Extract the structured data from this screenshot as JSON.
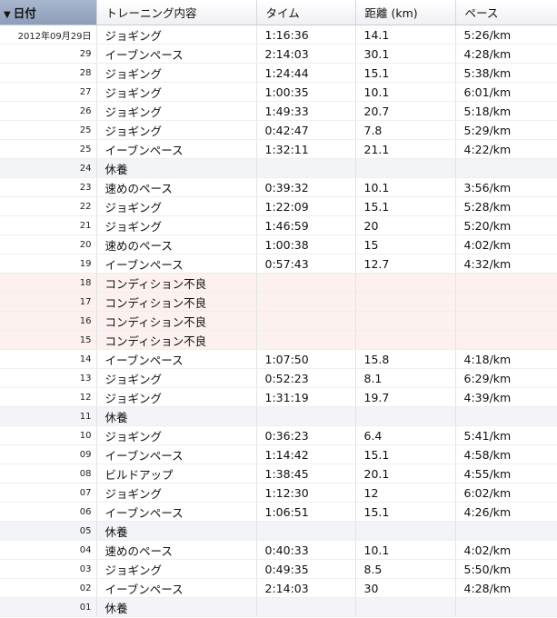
{
  "headers": {
    "date": "日付",
    "type": "トレーニング内容",
    "time": "タイム",
    "distance": "距離 (km)",
    "pace": "ペース"
  },
  "sort_indicator": "▼",
  "rows": [
    {
      "date": "2012年09月29日",
      "type": "ジョギング",
      "time": "1:16:36",
      "distance": "14.1",
      "pace": "5:26/km",
      "kind": "run"
    },
    {
      "date": "29",
      "type": "イーブンペース",
      "time": "2:14:03",
      "distance": "30.1",
      "pace": "4:28/km",
      "kind": "run"
    },
    {
      "date": "28",
      "type": "ジョギング",
      "time": "1:24:44",
      "distance": "15.1",
      "pace": "5:38/km",
      "kind": "run"
    },
    {
      "date": "27",
      "type": "ジョギング",
      "time": "1:00:35",
      "distance": "10.1",
      "pace": "6:01/km",
      "kind": "run"
    },
    {
      "date": "26",
      "type": "ジョギング",
      "time": "1:49:33",
      "distance": "20.7",
      "pace": "5:18/km",
      "kind": "run"
    },
    {
      "date": "25",
      "type": "ジョギング",
      "time": "0:42:47",
      "distance": "7.8",
      "pace": "5:29/km",
      "kind": "run"
    },
    {
      "date": "25",
      "type": "イーブンペース",
      "time": "1:32:11",
      "distance": "21.1",
      "pace": "4:22/km",
      "kind": "run"
    },
    {
      "date": "24",
      "type": "休養",
      "time": "",
      "distance": "",
      "pace": "",
      "kind": "rest"
    },
    {
      "date": "23",
      "type": "速めのペース",
      "time": "0:39:32",
      "distance": "10.1",
      "pace": "3:56/km",
      "kind": "run"
    },
    {
      "date": "22",
      "type": "ジョギング",
      "time": "1:22:09",
      "distance": "15.1",
      "pace": "5:28/km",
      "kind": "run"
    },
    {
      "date": "21",
      "type": "ジョギング",
      "time": "1:46:59",
      "distance": "20",
      "pace": "5:20/km",
      "kind": "run"
    },
    {
      "date": "20",
      "type": "速めのペース",
      "time": "1:00:38",
      "distance": "15",
      "pace": "4:02/km",
      "kind": "run"
    },
    {
      "date": "19",
      "type": "イーブンペース",
      "time": "0:57:43",
      "distance": "12.7",
      "pace": "4:32/km",
      "kind": "run"
    },
    {
      "date": "18",
      "type": "コンディション不良",
      "time": "",
      "distance": "",
      "pace": "",
      "kind": "ill"
    },
    {
      "date": "17",
      "type": "コンディション不良",
      "time": "",
      "distance": "",
      "pace": "",
      "kind": "ill"
    },
    {
      "date": "16",
      "type": "コンディション不良",
      "time": "",
      "distance": "",
      "pace": "",
      "kind": "ill"
    },
    {
      "date": "15",
      "type": "コンディション不良",
      "time": "",
      "distance": "",
      "pace": "",
      "kind": "ill"
    },
    {
      "date": "14",
      "type": "イーブンペース",
      "time": "1:07:50",
      "distance": "15.8",
      "pace": "4:18/km",
      "kind": "run"
    },
    {
      "date": "13",
      "type": "ジョギング",
      "time": "0:52:23",
      "distance": "8.1",
      "pace": "6:29/km",
      "kind": "run"
    },
    {
      "date": "12",
      "type": "ジョギング",
      "time": "1:31:19",
      "distance": "19.7",
      "pace": "4:39/km",
      "kind": "run"
    },
    {
      "date": "11",
      "type": "休養",
      "time": "",
      "distance": "",
      "pace": "",
      "kind": "rest"
    },
    {
      "date": "10",
      "type": "ジョギング",
      "time": "0:36:23",
      "distance": "6.4",
      "pace": "5:41/km",
      "kind": "run"
    },
    {
      "date": "09",
      "type": "イーブンペース",
      "time": "1:14:42",
      "distance": "15.1",
      "pace": "4:58/km",
      "kind": "run"
    },
    {
      "date": "08",
      "type": "ビルドアップ",
      "time": "1:38:45",
      "distance": "20.1",
      "pace": "4:55/km",
      "kind": "run"
    },
    {
      "date": "07",
      "type": "ジョギング",
      "time": "1:12:30",
      "distance": "12",
      "pace": "6:02/km",
      "kind": "run"
    },
    {
      "date": "06",
      "type": "イーブンペース",
      "time": "1:06:51",
      "distance": "15.1",
      "pace": "4:26/km",
      "kind": "run"
    },
    {
      "date": "05",
      "type": "休養",
      "time": "",
      "distance": "",
      "pace": "",
      "kind": "rest"
    },
    {
      "date": "04",
      "type": "速めのペース",
      "time": "0:40:33",
      "distance": "10.1",
      "pace": "4:02/km",
      "kind": "run"
    },
    {
      "date": "03",
      "type": "ジョギング",
      "time": "0:49:35",
      "distance": "8.5",
      "pace": "5:50/km",
      "kind": "run"
    },
    {
      "date": "02",
      "type": "イーブンペース",
      "time": "2:14:03",
      "distance": "30",
      "pace": "4:28/km",
      "kind": "run"
    },
    {
      "date": "01",
      "type": "休養",
      "time": "",
      "distance": "",
      "pace": "",
      "kind": "rest"
    }
  ]
}
